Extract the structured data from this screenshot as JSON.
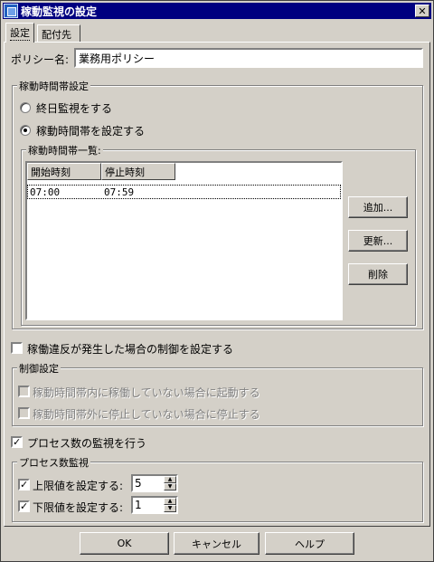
{
  "window": {
    "title": "稼動監視の設定",
    "close_label": "✕"
  },
  "tabs": [
    {
      "label": "設定"
    },
    {
      "label": "配付先"
    }
  ],
  "policy": {
    "label": "ポリシー名:",
    "value": "業務用ポリシー"
  },
  "operating_hours": {
    "group_title": "稼動時間帯設定",
    "radio_all_day": "終日監視をする",
    "radio_set_hours": "稼動時間帯を設定する",
    "selected": "set_hours",
    "list_group_title": "稼動時間帯一覧:",
    "columns": [
      "開始時刻",
      "停止時刻"
    ],
    "rows": [
      {
        "start": "07:00",
        "stop": "07:59"
      }
    ],
    "buttons": {
      "add": "追加...",
      "update": "更新...",
      "delete": "削除"
    }
  },
  "violation": {
    "checkbox_label": "稼働違反が発生した場合の制御を設定する",
    "checked": false,
    "group_title": "制御設定",
    "option_start": "稼動時間帯内に稼働していない場合に起動する",
    "option_stop": "稼動時間帯外に停止していない場合に停止する"
  },
  "process": {
    "checkbox_label": "プロセス数の監視を行う",
    "checked": true,
    "group_title": "プロセス数監視",
    "upper_label": "上限値を設定する:",
    "upper_checked": true,
    "upper_value": "5",
    "lower_label": "下限値を設定する:",
    "lower_checked": true,
    "lower_value": "1"
  },
  "footer": {
    "ok": "OK",
    "cancel": "キャンセル",
    "help": "ヘルプ"
  }
}
